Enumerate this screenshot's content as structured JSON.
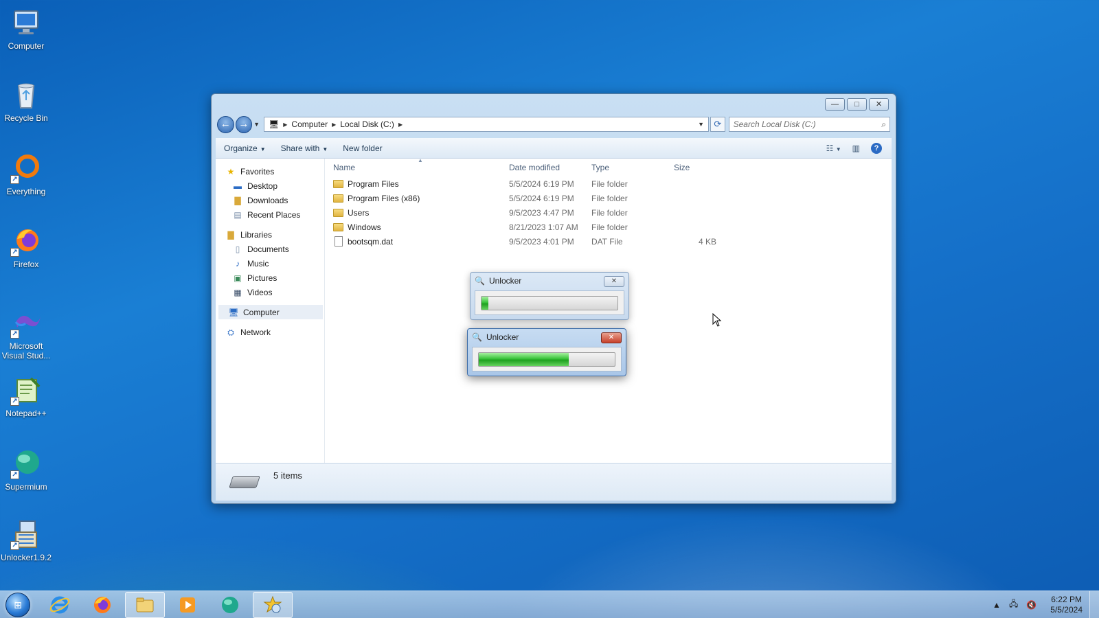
{
  "desktop": {
    "icons": [
      {
        "label": "Computer"
      },
      {
        "label": "Recycle Bin"
      },
      {
        "label": "Everything"
      },
      {
        "label": "Firefox"
      },
      {
        "label": "Microsoft Visual Stud..."
      },
      {
        "label": "Notepad++"
      },
      {
        "label": "Supermium"
      },
      {
        "label": "Unlocker1.9.2"
      }
    ]
  },
  "explorer": {
    "breadcrumb": [
      "Computer",
      "Local Disk (C:)"
    ],
    "search_placeholder": "Search Local Disk (C:)",
    "toolbar": {
      "organize": "Organize",
      "share_with": "Share with",
      "new_folder": "New folder"
    },
    "nav": {
      "favorites": "Favorites",
      "favorites_items": [
        "Desktop",
        "Downloads",
        "Recent Places"
      ],
      "libraries": "Libraries",
      "libraries_items": [
        "Documents",
        "Music",
        "Pictures",
        "Videos"
      ],
      "computer": "Computer",
      "network": "Network"
    },
    "columns": {
      "name": "Name",
      "date": "Date modified",
      "type": "Type",
      "size": "Size"
    },
    "files": [
      {
        "name": "Program Files",
        "date": "5/5/2024 6:19 PM",
        "type": "File folder",
        "size": "",
        "kind": "folder"
      },
      {
        "name": "Program Files (x86)",
        "date": "5/5/2024 6:19 PM",
        "type": "File folder",
        "size": "",
        "kind": "folder"
      },
      {
        "name": "Users",
        "date": "9/5/2023 4:47 PM",
        "type": "File folder",
        "size": "",
        "kind": "folder"
      },
      {
        "name": "Windows",
        "date": "8/21/2023 1:07 AM",
        "type": "File folder",
        "size": "",
        "kind": "folder"
      },
      {
        "name": "bootsqm.dat",
        "date": "9/5/2023 4:01 PM",
        "type": "DAT File",
        "size": "4 KB",
        "kind": "file"
      }
    ],
    "status": "5 items"
  },
  "dialogs": [
    {
      "title": "Unlocker",
      "progress_percent": 5,
      "active": false
    },
    {
      "title": "Unlocker",
      "progress_percent": 66,
      "active": true
    }
  ],
  "taskbar": {
    "apps": [
      "internet-explorer",
      "firefox",
      "windows-explorer",
      "media-player",
      "supermium",
      "unlocker"
    ],
    "time": "6:22 PM",
    "date": "5/5/2024"
  },
  "colors": {
    "desktop_blue": "#1570c9",
    "progress_green": "#38c33a",
    "close_red": "#c7412b"
  }
}
